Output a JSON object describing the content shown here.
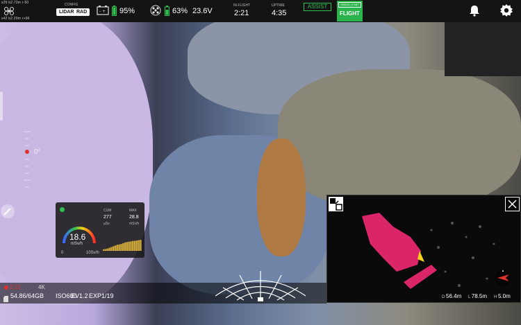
{
  "top_left": {
    "coord_line1": "s29 b2.73m r-50",
    "coord_line2": "s42 b2.29m r+96"
  },
  "config": {
    "header": "CONFIG",
    "lidar_label": "LIDAR",
    "rad_label": "RAD"
  },
  "battery1": {
    "percent": "95%"
  },
  "battery2": {
    "percent": "63%",
    "voltage": "23.6V"
  },
  "in_flight": {
    "header": "IN FLIGHT",
    "value": "2:21"
  },
  "uptime": {
    "header": "UPTIME",
    "value": "4:35"
  },
  "assist_label": "ASSIST",
  "flight": {
    "id": "000241 | F067",
    "label": "FLIGHT"
  },
  "gimbal": {
    "angle": "0°"
  },
  "dose": {
    "cum_header": "CUM",
    "cum_value": "277",
    "cum_unit": "µSv",
    "max_header": "MAX",
    "max_value": "28.8",
    "max_unit": "mSv/h",
    "rate_value": "18.6",
    "rate_unit": "mSv/h",
    "scale_min": "0",
    "scale_max": "10Sv/h",
    "gauge_fraction": 0.55,
    "status_color": "#2ec14f",
    "history": [
      0.1,
      0.12,
      0.15,
      0.2,
      0.25,
      0.3,
      0.35,
      0.4,
      0.42,
      0.45,
      0.5,
      0.55,
      0.58,
      0.6,
      0.62,
      0.65,
      0.66,
      0.68,
      0.7,
      0.72
    ]
  },
  "recording": {
    "time": "2:21",
    "resolution": "4K",
    "storage": "54.86/64GB",
    "iso": "ISO600",
    "ev": "EV1.2",
    "exp": "EXP1/19"
  },
  "lidar_panel": {
    "d_value": "56.4m",
    "l_value": "78.5m",
    "h_value": "5.0m"
  },
  "colors": {
    "accent_green": "#2ec14f",
    "record_red": "#e0302a",
    "lidar_magenta": "#ff2a7a"
  }
}
